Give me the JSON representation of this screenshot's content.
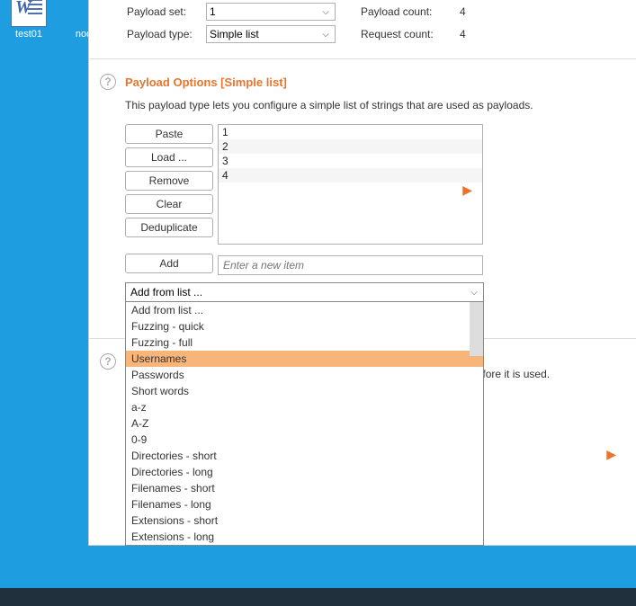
{
  "desktop": {
    "icons": [
      {
        "label": "test01"
      },
      {
        "label": "node-"
      }
    ]
  },
  "topSettings": {
    "payloadSetLabel": "Payload set:",
    "payloadSetValue": "1",
    "payloadTypeLabel": "Payload type:",
    "payloadTypeValue": "Simple list",
    "payloadCountLabel": "Payload count:",
    "payloadCountValue": "4",
    "requestCountLabel": "Request count:",
    "requestCountValue": "4"
  },
  "payloadOptions": {
    "title": "Payload Options [Simple list]",
    "description": "This payload type lets you configure a simple list of strings that are used as payloads.",
    "buttons": {
      "paste": "Paste",
      "load": "Load ...",
      "remove": "Remove",
      "clear": "Clear",
      "deduplicate": "Deduplicate",
      "add": "Add"
    },
    "items": [
      "1",
      "2",
      "3",
      "4"
    ],
    "addPlaceholder": "Enter a new item",
    "addFromListSelected": "Add from list ...",
    "addFromListOptions": [
      "Add from list ...",
      "Fuzzing - quick",
      "Fuzzing - full",
      "Usernames",
      "Passwords",
      "Short words",
      "a-z",
      "A-Z",
      "0-9",
      "Directories - short",
      "Directories - long",
      "Filenames - short",
      "Filenames - long",
      "Extensions - short",
      "Extensions - long"
    ],
    "highlightedOption": "Usernames"
  },
  "processing": {
    "descriptionTail": "load before it is used."
  }
}
